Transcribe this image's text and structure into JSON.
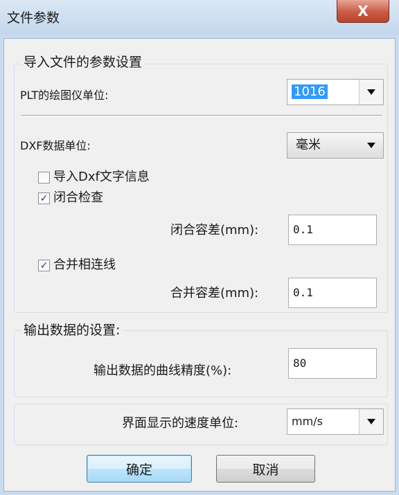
{
  "window": {
    "title": "文件参数",
    "close_glyph": "X"
  },
  "import_group": {
    "legend": "导入文件的参数设置",
    "plt_unit": {
      "label": "PLT的绘图仪单位:",
      "value": "1016"
    },
    "dxf_unit": {
      "label": "DXF数据单位:",
      "value": "毫米"
    },
    "import_dxf_text": {
      "label": "导入Dxf文字信息",
      "checked": false
    },
    "closure_check": {
      "label": "闭合检查",
      "checked": true
    },
    "closure_tolerance": {
      "label": "闭合容差(mm):",
      "value": "0.1"
    },
    "merge_lines": {
      "label": "合并相连线",
      "checked": true
    },
    "merge_tolerance": {
      "label": "合并容差(mm):",
      "value": "0.1"
    }
  },
  "output_group": {
    "legend": "输出数据的设置:",
    "curve_precision": {
      "label": "输出数据的曲线精度(%):",
      "value": "80"
    }
  },
  "speed_group": {
    "label": "界面显示的速度单位:",
    "value": "mm/s"
  },
  "buttons": {
    "ok": "确定",
    "cancel": "取消"
  },
  "check_glyph": "✓"
}
